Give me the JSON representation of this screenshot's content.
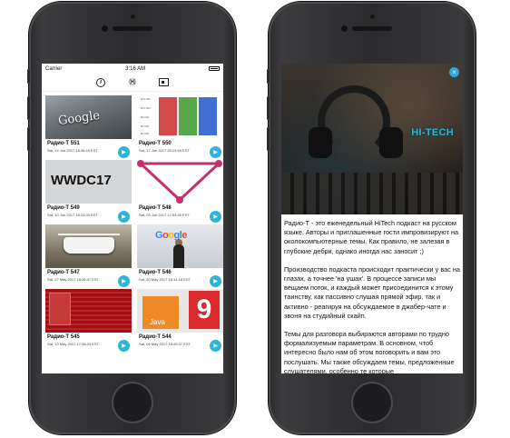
{
  "status_bar": {
    "carrier": "Carrier",
    "time": "3:16 AM"
  },
  "toolbar": {
    "icons": [
      "info-icon",
      "radio-icon",
      "news-icon"
    ]
  },
  "episodes": [
    {
      "title": "Радио-Т 551",
      "date": "Sat, 24 Jun 2017 18:36:49 EST"
    },
    {
      "title": "Радио-Т 550",
      "date": "Sat, 17 Jun 2017 20:13:59 EST"
    },
    {
      "title": "Радио-Т 549",
      "date": "Sat, 10 Jun 2017 18:24:00 EST"
    },
    {
      "title": "Радио-Т 548",
      "date": "Sat, 03 Jun 2017 17:53:45 EST"
    },
    {
      "title": "Радио-Т 547",
      "date": "Sat, 27 May 2017 18:26:47 EST"
    },
    {
      "title": "Радио-Т 546",
      "date": "Sat, 20 May 2017 18:14:18 EST"
    },
    {
      "title": "Радио-Т 545",
      "date": "Sat, 13 May 2017 17:38:24 EST"
    },
    {
      "title": "Радио-Т 544",
      "date": "Sat, 06 May 2017 18:49:37 EST"
    }
  ],
  "thumb_text": {
    "google_wall": "Google",
    "chart_ticks": [
      "$15,000",
      "$12,000",
      "$9,000",
      "$6,000",
      "$3,000"
    ],
    "wwdc": "WWDC17",
    "google_stage": "Google",
    "java": "Java",
    "nine": "9"
  },
  "detail": {
    "brand": "HI-TECH",
    "paragraphs": [
      "Радио-Т - это еженедельный HiTech подкаст на русском языке. Авторы и приглашенные гости импровизируют на околокомпьютерные темы. Как правило, не залезая в глубокие дебри, однако иногда нас заносит ;)",
      "Производство подкаста происходит практически у вас на глазах, а точнее 'на ушах'. В процессе записи мы вещаем поток, и каждый может присоединится к этому таинству, как пассивно слушая прямой эфир, так и активно - реагируя на обсуждаемое в джабер-чате и звоня на студийный скайп.",
      "Темы для разговора выбираются авторами по трудно формализуемым параметрам. В основном, чтоб интересно было нам об этом поговорить и вам это послушать. Мы также обсуждаем темы, предложенные слушателями, особенно те которые"
    ]
  },
  "colors": {
    "accent": "#2fb4d8",
    "brand": "#27b9d6"
  }
}
